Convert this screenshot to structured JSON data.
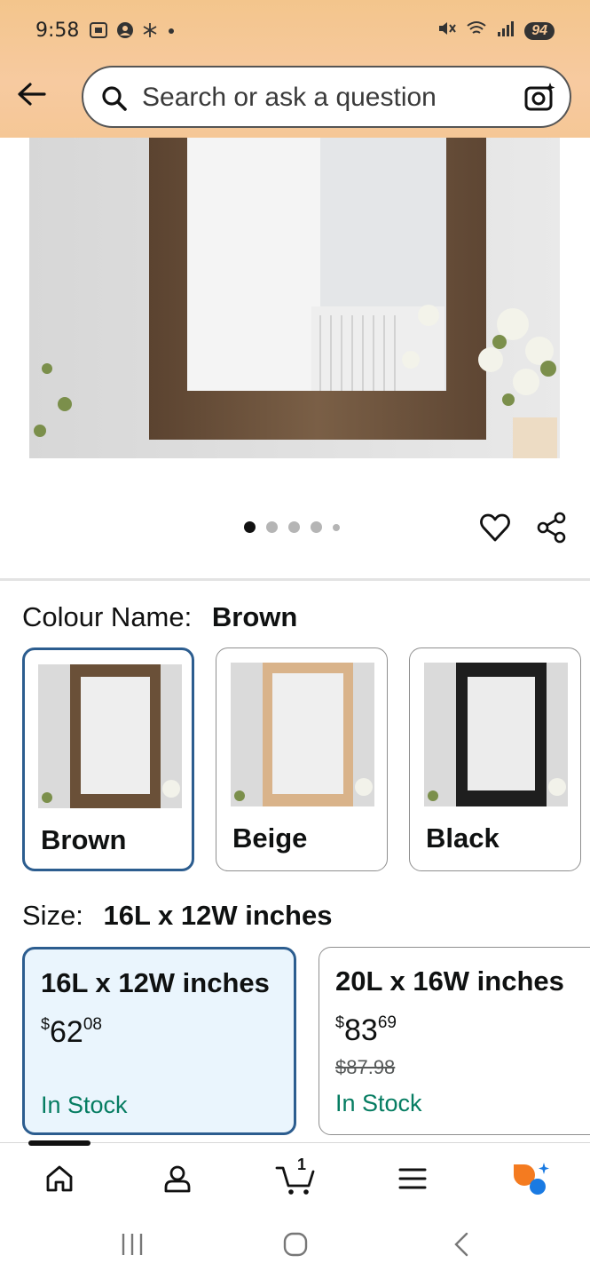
{
  "status_bar": {
    "time": "9:58",
    "battery": "94"
  },
  "search": {
    "placeholder": "Search or ask a question"
  },
  "gallery": {
    "image_count": 5,
    "active_index": 0
  },
  "colour": {
    "label": "Colour Name:",
    "selected": "Brown",
    "options": [
      {
        "name": "Brown",
        "frame_color": "#6a5038"
      },
      {
        "name": "Beige",
        "frame_color": "#d9b38a"
      },
      {
        "name": "Black",
        "frame_color": "#1e1e1e"
      }
    ]
  },
  "size": {
    "label": "Size:",
    "selected": "16L x 12W inches",
    "options": [
      {
        "name": "16L x 12W inches",
        "currency": "$",
        "price_whole": "62",
        "price_cents": "08",
        "stock": "In Stock"
      },
      {
        "name": "20L x 16W inches",
        "currency": "$",
        "price_whole": "83",
        "price_cents": "69",
        "was_price": "$87.98",
        "stock": "In Stock"
      }
    ]
  },
  "bottom_nav": {
    "cart_count": "1",
    "items": [
      "home-icon",
      "account-icon",
      "cart-icon",
      "menu-icon",
      "rufus-icon"
    ]
  },
  "colors": {
    "header_bg": "#f5c796",
    "selected_border": "#2c5d8f",
    "selected_bg": "#eaf5fd",
    "in_stock": "#067d62"
  }
}
